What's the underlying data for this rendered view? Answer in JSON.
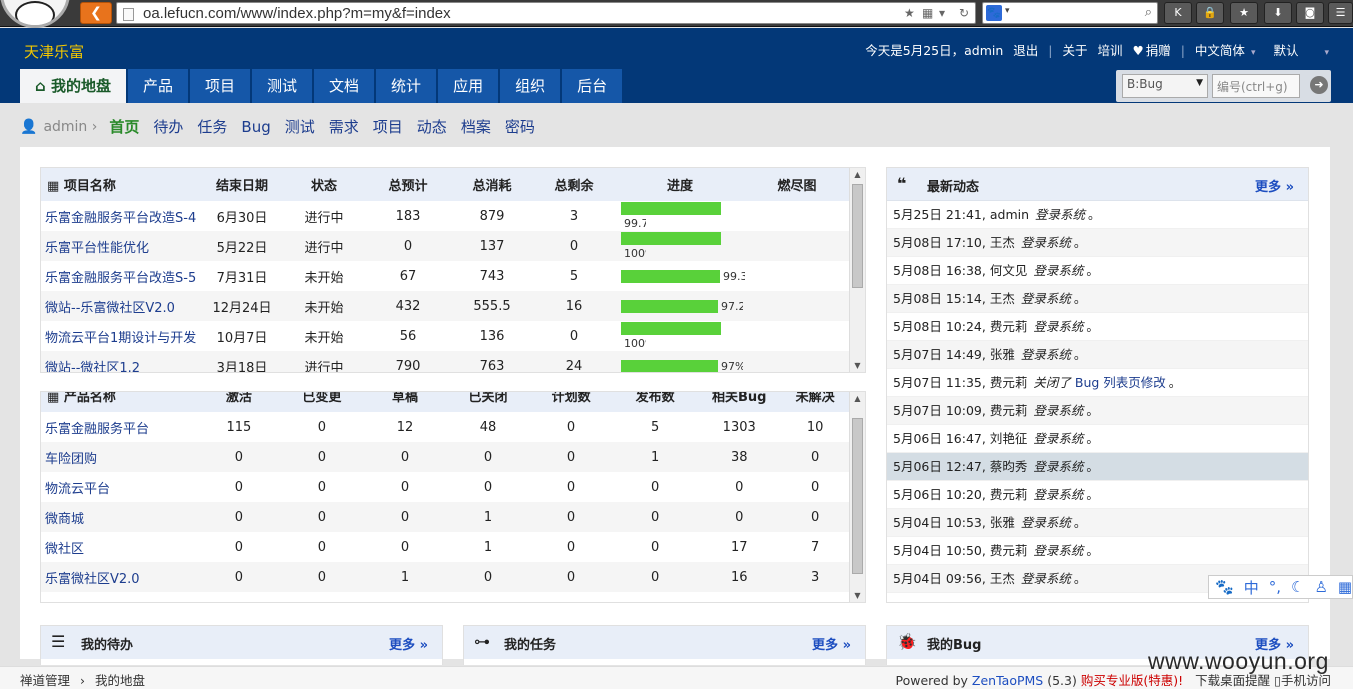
{
  "browser": {
    "url": "oa.lefucn.com/www/index.php?m=my&f=index",
    "search_engine_icon": "baidu-paw-icon"
  },
  "header": {
    "brand": "天津乐富",
    "date_text": "今天是5月25日，",
    "user": "admin",
    "logout": "退出",
    "about": "关于",
    "training": "培训",
    "donate": "捐赠",
    "language": "中文简体",
    "theme": "默认"
  },
  "tabs": [
    "我的地盘",
    "产品",
    "项目",
    "测试",
    "文档",
    "统计",
    "应用",
    "组织",
    "后台"
  ],
  "finder": {
    "select_value": "B:Bug",
    "number_placeholder": "编号(ctrl+g)"
  },
  "subnav": {
    "user": "admin",
    "items": [
      "首页",
      "待办",
      "任务",
      "Bug",
      "测试",
      "需求",
      "项目",
      "动态",
      "档案",
      "密码"
    ]
  },
  "projects": {
    "headers": [
      "项目名称",
      "结束日期",
      "状态",
      "总预计",
      "总消耗",
      "总剩余",
      "进度",
      "燃尽图"
    ],
    "rows": [
      {
        "name": "乐富金融服务平台改造S-4",
        "end": "6月30日",
        "status": "进行中",
        "est": "183",
        "consumed": "879",
        "left": "3",
        "progress": 99.7,
        "pct": "99.7%"
      },
      {
        "name": "乐富平台性能优化",
        "end": "5月22日",
        "status": "进行中",
        "est": "0",
        "consumed": "137",
        "left": "0",
        "progress": 100,
        "pct": "100%"
      },
      {
        "name": "乐富金融服务平台改造S-5",
        "end": "7月31日",
        "status": "未开始",
        "est": "67",
        "consumed": "743",
        "left": "5",
        "progress": 99.3,
        "pct": "99.3%"
      },
      {
        "name": "微站--乐富微社区V2.0",
        "end": "12月24日",
        "status": "未开始",
        "est": "432",
        "consumed": "555.5",
        "left": "16",
        "progress": 97.2,
        "pct": "97.2%"
      },
      {
        "name": "物流云平台1期设计与开发",
        "end": "10月7日",
        "status": "未开始",
        "est": "56",
        "consumed": "136",
        "left": "0",
        "progress": 100,
        "pct": "100%"
      },
      {
        "name": "微站--微社区1.2",
        "end": "3月18日",
        "status": "进行中",
        "est": "790",
        "consumed": "763",
        "left": "24",
        "progress": 97,
        "pct": "97%"
      }
    ]
  },
  "products": {
    "headers": [
      "产品名称",
      "激活",
      "已变更",
      "草稿",
      "已关闭",
      "计划数",
      "发布数",
      "相关Bug",
      "未解决"
    ],
    "rows": [
      [
        "乐富金融服务平台",
        "115",
        "0",
        "12",
        "48",
        "0",
        "5",
        "1303",
        "10"
      ],
      [
        "车险团购",
        "0",
        "0",
        "0",
        "0",
        "0",
        "1",
        "38",
        "0"
      ],
      [
        "物流云平台",
        "0",
        "0",
        "0",
        "0",
        "0",
        "0",
        "0",
        "0"
      ],
      [
        "微商城",
        "0",
        "0",
        "0",
        "1",
        "0",
        "0",
        "0",
        "0"
      ],
      [
        "微社区",
        "0",
        "0",
        "0",
        "1",
        "0",
        "0",
        "17",
        "7"
      ],
      [
        "乐富微社区V2.0",
        "0",
        "0",
        "1",
        "0",
        "0",
        "0",
        "16",
        "3"
      ]
    ]
  },
  "feed": {
    "title": "最新动态",
    "more": "更多",
    "items": [
      {
        "time": "5月25日 21:41,",
        "who": "admin",
        "action": "登录系统",
        "target": "",
        "end": "。"
      },
      {
        "time": "5月08日 17:10,",
        "who": "王杰",
        "action": "登录系统",
        "target": "",
        "end": "。"
      },
      {
        "time": "5月08日 16:38,",
        "who": "何文见",
        "action": "登录系统",
        "target": "",
        "end": "。"
      },
      {
        "time": "5月08日 15:14,",
        "who": "王杰",
        "action": "登录系统",
        "target": "",
        "end": "。"
      },
      {
        "time": "5月08日 10:24,",
        "who": "费元莉",
        "action": "登录系统",
        "target": "",
        "end": "。"
      },
      {
        "time": "5月07日 14:49,",
        "who": "张雅",
        "action": "登录系统",
        "target": "",
        "end": "。"
      },
      {
        "time": "5月07日 11:35,",
        "who": "费元莉",
        "action": "关闭了",
        "target": "Bug 列表页修改",
        "end": "。"
      },
      {
        "time": "5月07日 10:09,",
        "who": "费元莉",
        "action": "登录系统",
        "target": "",
        "end": "。"
      },
      {
        "time": "5月06日 16:47,",
        "who": "刘艳征",
        "action": "登录系统",
        "target": "",
        "end": "。"
      },
      {
        "time": "5月06日 12:47,",
        "who": "蔡昀秀",
        "action": "登录系统",
        "target": "",
        "end": "。"
      },
      {
        "time": "5月06日 10:20,",
        "who": "费元莉",
        "action": "登录系统",
        "target": "",
        "end": "。"
      },
      {
        "time": "5月04日 10:53,",
        "who": "张雅",
        "action": "登录系统",
        "target": "",
        "end": "。"
      },
      {
        "time": "5月04日 10:50,",
        "who": "费元莉",
        "action": "登录系统",
        "target": "",
        "end": "。"
      },
      {
        "time": "5月04日 09:56,",
        "who": "王杰",
        "action": "登录系统",
        "target": "",
        "end": "。"
      }
    ]
  },
  "blocks": {
    "todo": {
      "title": "我的待办",
      "more": "更多"
    },
    "tasks": {
      "title": "我的任务",
      "more": "更多"
    },
    "bugs": {
      "title": "我的Bug",
      "more": "更多"
    }
  },
  "footer": {
    "crumb": [
      "禅道管理",
      "我的地盘"
    ],
    "powered": "Powered by",
    "zentao": "ZenTaoPMS",
    "version": "(5.3)",
    "buy": "购买专业版(特惠)!",
    "download": "下载桌面提醒",
    "mobile": "手机访问"
  },
  "watermark": "www.wooyun.org",
  "ime": {
    "lang": "中"
  }
}
